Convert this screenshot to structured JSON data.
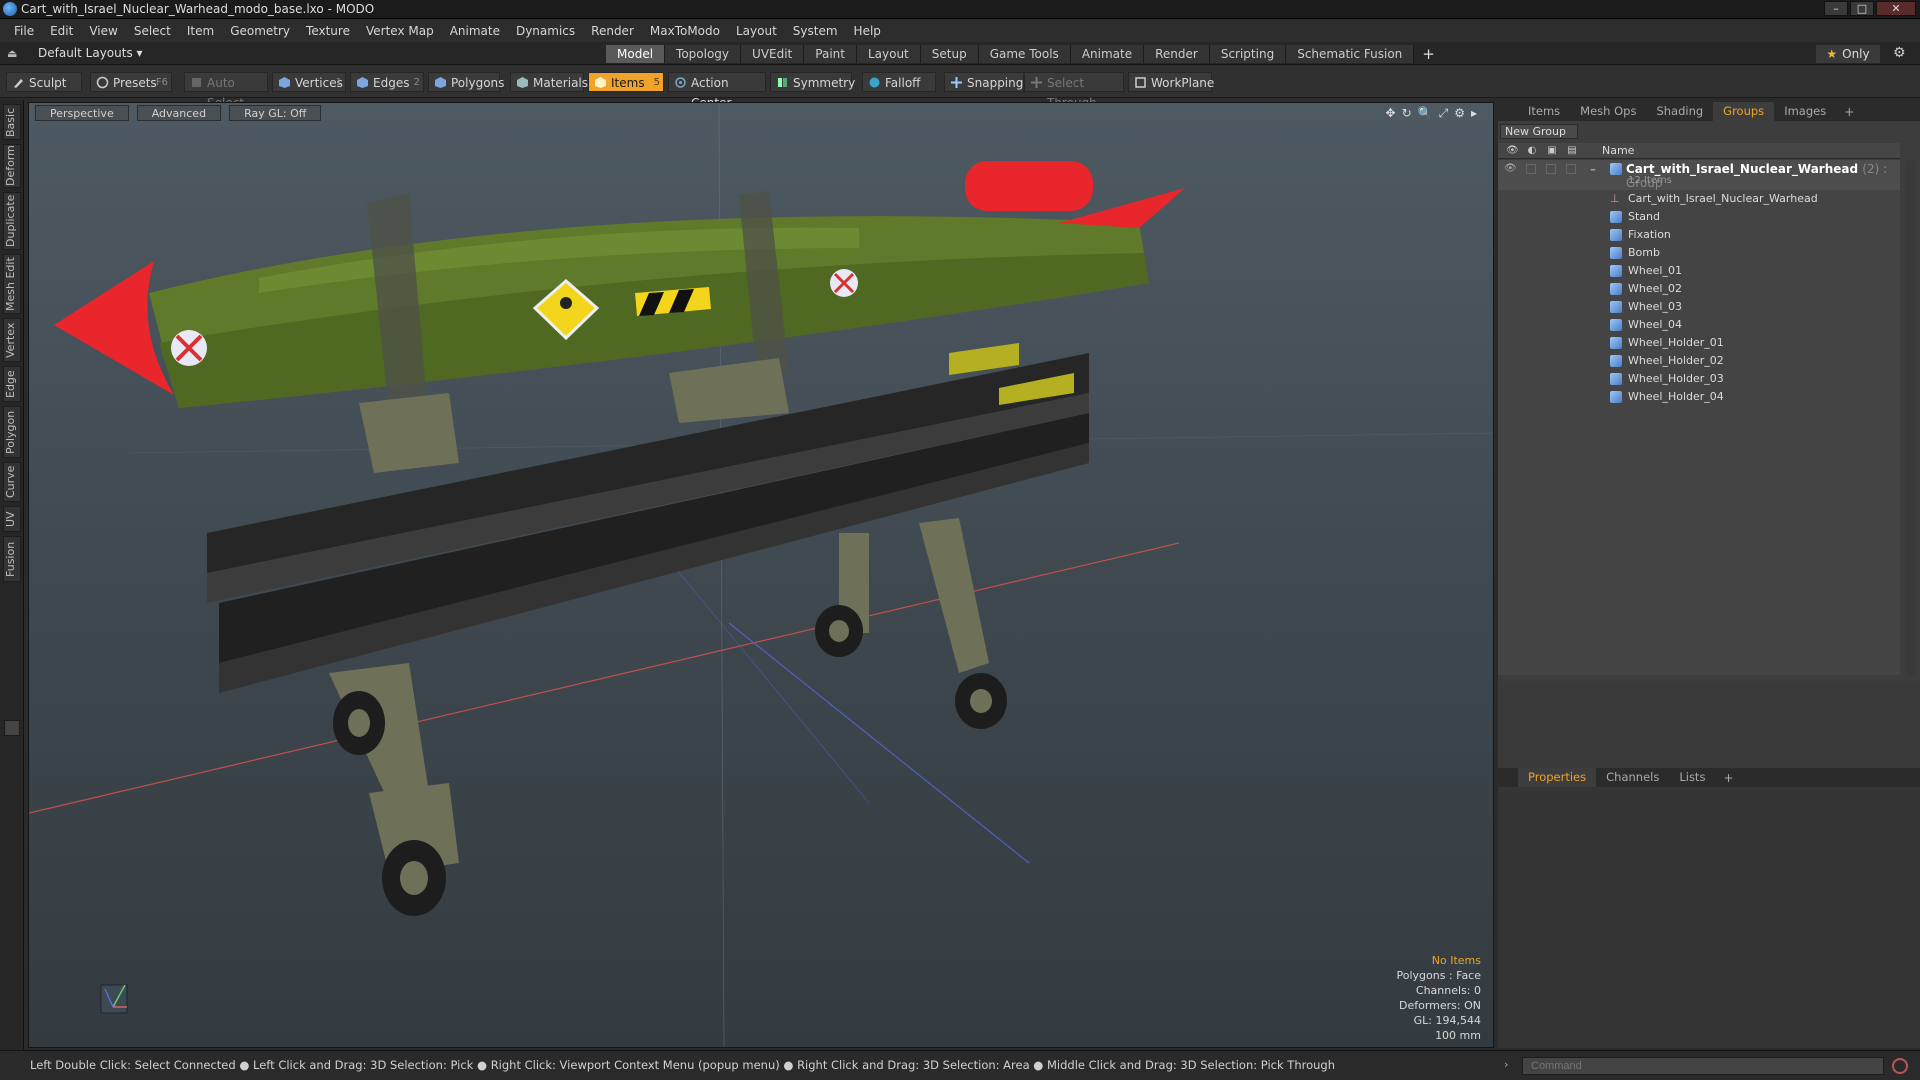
{
  "window": {
    "title": "Cart_with_Israel_Nuclear_Warhead_modo_base.lxo - MODO",
    "controls": [
      "–",
      "□",
      "✕"
    ]
  },
  "menu": [
    "File",
    "Edit",
    "View",
    "Select",
    "Item",
    "Geometry",
    "Texture",
    "Vertex Map",
    "Animate",
    "Dynamics",
    "Render",
    "MaxToModo",
    "Layout",
    "System",
    "Help"
  ],
  "layout_bar": {
    "default_layouts": "Default Layouts ▾",
    "tabs": [
      "Model",
      "Topology",
      "UVEdit",
      "Paint",
      "Layout",
      "Setup",
      "Game Tools",
      "Animate",
      "Render",
      "Scripting",
      "Schematic Fusion"
    ],
    "active_tab": "Model",
    "only_label": "Only"
  },
  "toolbar": {
    "sculpt": "Sculpt",
    "presets": "Presets",
    "presets_key": "F6",
    "auto_select": "Auto Select",
    "vertices": "Vertices",
    "vertices_num": "1",
    "edges": "Edges",
    "edges_num": "2",
    "polygons": "Polygons",
    "materials": "Materials",
    "items": "Items",
    "items_num": "5",
    "action_center": "Action Center",
    "symmetry": "Symmetry",
    "falloff": "Falloff",
    "snapping": "Snapping",
    "select_through": "Select Through",
    "workplane": "WorkPlane"
  },
  "left_tabs": [
    "Basic",
    "Deform",
    "Duplicate",
    "Mesh Edit",
    "Vertex",
    "Edge",
    "Polygon",
    "Curve",
    "UV",
    "Fusion"
  ],
  "viewport": {
    "perspective": "Perspective",
    "advanced": "Advanced",
    "raygl": "Ray GL: Off",
    "info": {
      "no_items": "No Items",
      "polygons": "Polygons : Face",
      "channels": "Channels: 0",
      "deformers": "Deformers: ON",
      "gl": "GL: 194,544",
      "size": "100 mm"
    }
  },
  "right_panel": {
    "tabs": [
      "Items",
      "Mesh Ops",
      "Shading",
      "Groups",
      "Images"
    ],
    "active_tab": "Groups",
    "new_group": "New Group",
    "name_header": "Name",
    "group": {
      "name": "Cart_with_Israel_Nuclear_Warhead",
      "meta": "(2) : Group",
      "count": "12 Items"
    },
    "items": [
      "Cart_with_Israel_Nuclear_Warhead",
      "Stand",
      "Fixation",
      "Bomb",
      "Wheel_01",
      "Wheel_02",
      "Wheel_03",
      "Wheel_04",
      "Wheel_Holder_01",
      "Wheel_Holder_02",
      "Wheel_Holder_03",
      "Wheel_Holder_04"
    ],
    "props_tabs": [
      "Properties",
      "Channels",
      "Lists"
    ],
    "props_active": "Properties"
  },
  "status": {
    "hint": "Left Double Click: Select Connected ● Left Click and Drag: 3D Selection: Pick ● Right Click: Viewport Context Menu (popup menu) ● Right Click and Drag: 3D Selection: Area ● Middle Click and Drag: 3D Selection: Pick Through",
    "command_placeholder": "Command"
  },
  "colors": {
    "accent": "#f0a229",
    "bomb_body": "#5f7a2a",
    "nose": "#e8262c"
  }
}
